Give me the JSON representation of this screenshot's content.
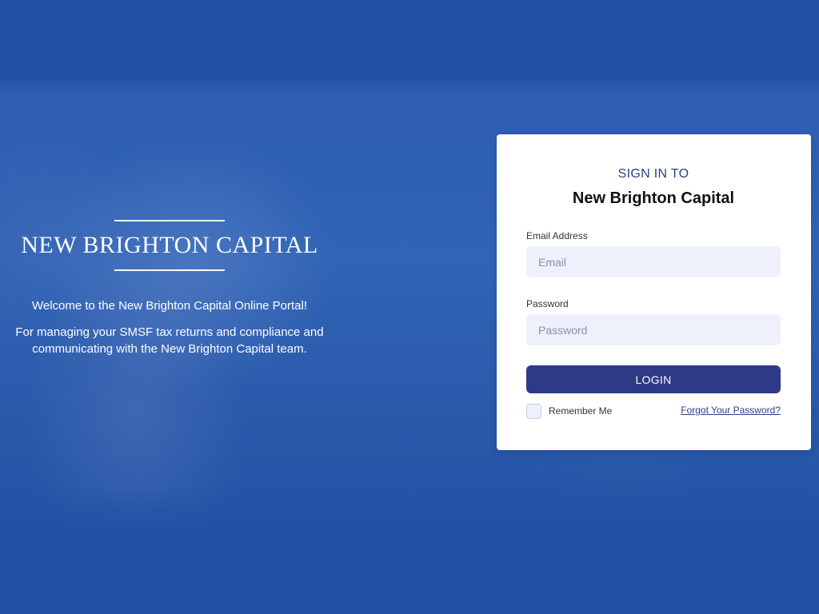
{
  "brand": {
    "name": "NEW BRIGHTON CAPITAL",
    "welcome": "Welcome to the New Brighton Capital Online Portal!",
    "description": "For managing your SMSF tax returns and compliance and communicating with the New Brighton Capital team."
  },
  "login": {
    "eyebrow": "SIGN IN TO",
    "title": "New Brighton Capital",
    "email_label": "Email Address",
    "email_placeholder": "Email",
    "email_value": "",
    "password_label": "Password",
    "password_placeholder": "Password",
    "password_value": "",
    "login_button": "LOGIN",
    "remember_label": "Remember Me",
    "remember_checked": false,
    "forgot_link": "Forgot Your Password?"
  },
  "colors": {
    "background": "#2252a4",
    "accent": "#2f3a86",
    "input_bg": "#eef1fc"
  }
}
